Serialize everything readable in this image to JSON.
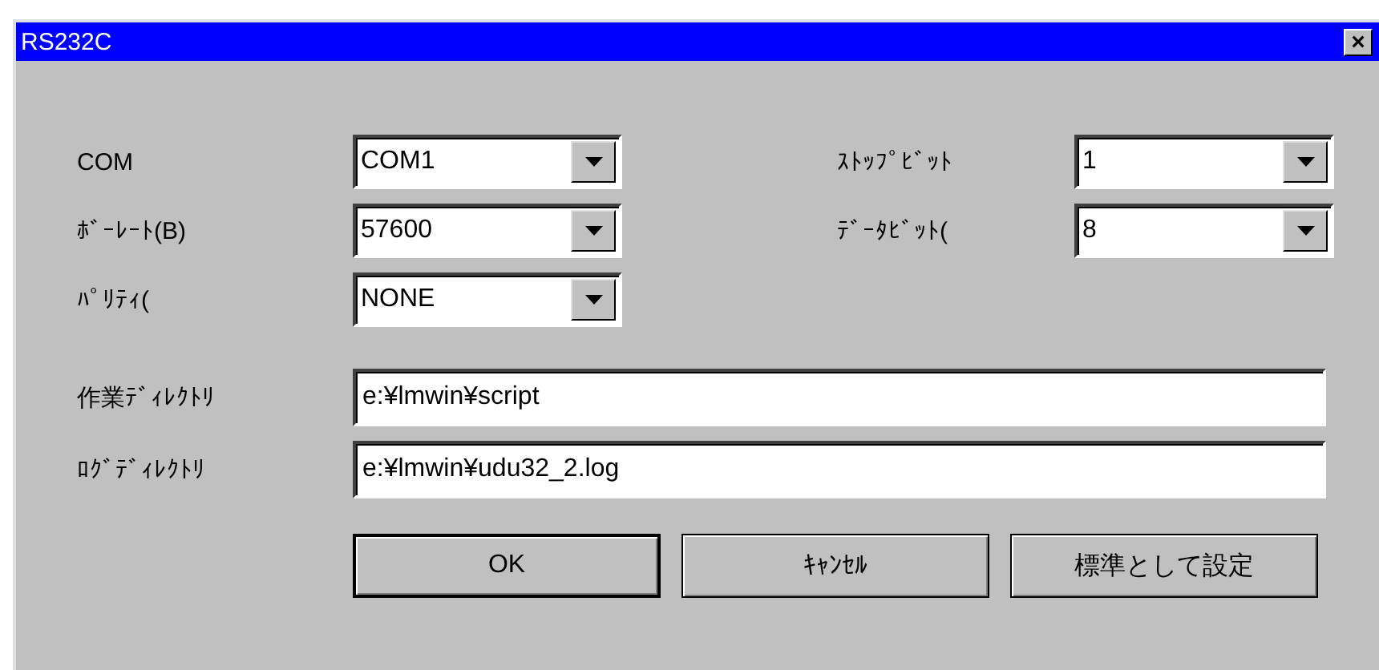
{
  "window": {
    "title": "RS232C",
    "close": "×"
  },
  "left_settings": [
    {
      "label": "COM",
      "value": "COM1"
    },
    {
      "label": "ﾎﾞｰﾚｰﾄ(B)",
      "value": "57600"
    },
    {
      "label": "ﾊﾟﾘﾃｨ(",
      "value": "NONE"
    }
  ],
  "right_settings": [
    {
      "label": "ｽﾄｯﾌﾟﾋﾞｯﾄ",
      "value": "1"
    },
    {
      "label": "ﾃﾞｰﾀﾋﾞｯﾄ(",
      "value": "8"
    }
  ],
  "directories": [
    {
      "label": "作業ﾃﾞｨﾚｸﾄﾘ",
      "value": "e:¥lmwin¥script"
    },
    {
      "label": "ﾛｸﾞﾃﾞｨﾚｸﾄﾘ",
      "value": "e:¥lmwin¥udu32_2.log"
    }
  ],
  "buttons": [
    {
      "label": "OK",
      "default": true
    },
    {
      "label": "ｷｬﾝｾﾙ",
      "default": false
    },
    {
      "label": "標準として設定",
      "default": false
    }
  ]
}
